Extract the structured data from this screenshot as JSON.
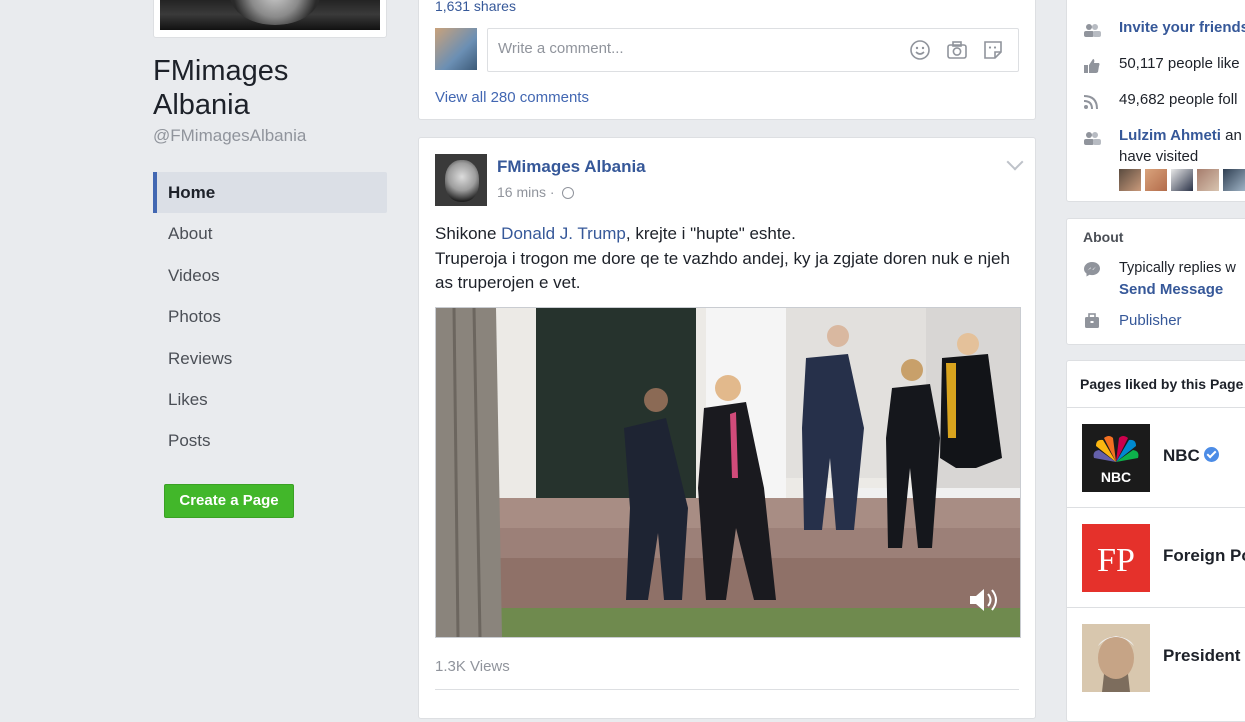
{
  "page": {
    "name": "FMimages Albania",
    "handle": "@FMimagesAlbania"
  },
  "nav": {
    "items": [
      {
        "label": "Home",
        "active": true
      },
      {
        "label": "About"
      },
      {
        "label": "Videos"
      },
      {
        "label": "Photos"
      },
      {
        "label": "Reviews"
      },
      {
        "label": "Likes"
      },
      {
        "label": "Posts"
      }
    ],
    "create_page_label": "Create a Page"
  },
  "previous_post": {
    "shares": "1,631 shares",
    "comment_placeholder": "Write a comment...",
    "view_all_comments": "View all 280 comments"
  },
  "post": {
    "author": "FMimages Albania",
    "time": "16 mins",
    "separator": "·",
    "text_before_tag": "Shikone ",
    "tag": "Donald J. Trump",
    "text_after_tag": ", krejte i \"hupte\" eshte.",
    "text_line2": "Truperoja i trogon me dore qe te vazhdo andej, ky ja zgjate doren nuk e njeh as truperojen e vet.",
    "views": "1.3K Views"
  },
  "sidebar_right": {
    "community": {
      "invite": "Invite your friends",
      "likes": "50,117 people like",
      "follows": "49,682 people foll",
      "visited_name": "Lulzim Ahmeti",
      "visited_suffix": " an",
      "visited_line2": "have visited"
    },
    "about": {
      "heading": "About",
      "replies": "Typically replies w",
      "send_message": "Send Message",
      "category": "Publisher"
    },
    "liked_pages": {
      "heading": "Pages liked by this Page",
      "items": [
        {
          "name": "NBC",
          "verified": true
        },
        {
          "name": "Foreign Po"
        },
        {
          "name": "President"
        }
      ]
    }
  },
  "colors": {
    "link": "#365899",
    "accent": "#4267b2",
    "create_button": "#42b72a",
    "background": "#e9ebee"
  },
  "icons": [
    "smile-icon",
    "camera-icon",
    "sticker-icon",
    "globe-icon",
    "speaker-icon",
    "people-icon",
    "thumbs-up-icon",
    "rss-icon",
    "messenger-icon",
    "briefcase-icon",
    "verified-icon",
    "chevron-down-icon"
  ]
}
